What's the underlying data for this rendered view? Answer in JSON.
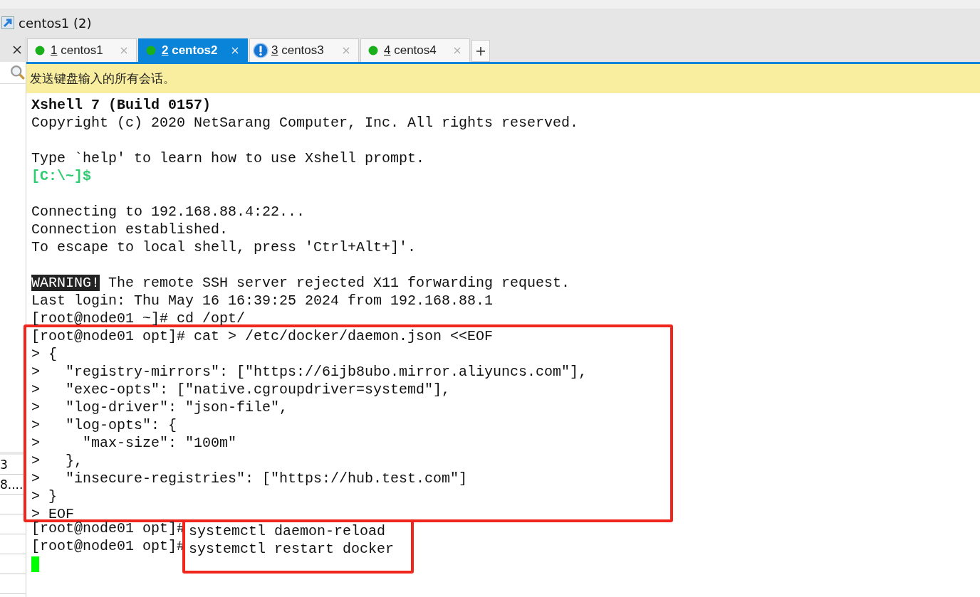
{
  "window": {
    "title": "centos1 (2)"
  },
  "tabs": [
    {
      "number": "1",
      "label": "centos1",
      "kind": "connected",
      "selected": false
    },
    {
      "number": "2",
      "label": "centos2",
      "kind": "connected",
      "selected": true
    },
    {
      "number": "3",
      "label": "centos3",
      "kind": "alert",
      "selected": false
    },
    {
      "number": "4",
      "label": "centos4",
      "kind": "connected",
      "selected": false
    }
  ],
  "banner": "发送键盘输入的所有会话。",
  "sidebar": {
    "items": [
      "3",
      "8...."
    ]
  },
  "terminal": {
    "blocks": [
      {
        "kind": "plain",
        "lines": [
          {
            "kind": "bold",
            "text": "Xshell 7 (Build 0157)"
          },
          {
            "kind": "plain",
            "text": "Copyright (c) 2020 NetSarang Computer, Inc. All rights reserved."
          },
          {
            "kind": "blank"
          },
          {
            "kind": "plain",
            "text": "Type `help' to learn how to use Xshell prompt."
          },
          {
            "kind": "prompt",
            "text": "[C:\\~]$"
          },
          {
            "kind": "blank"
          },
          {
            "kind": "plain",
            "text": "Connecting to 192.168.88.4:22..."
          },
          {
            "kind": "plain",
            "text": "Connection established."
          },
          {
            "kind": "plain",
            "text": "To escape to local shell, press 'Ctrl+Alt+]'."
          },
          {
            "kind": "blank"
          },
          {
            "kind": "warning",
            "label": "WARNING!",
            "text": " The remote SSH server rejected X11 forwarding request."
          },
          {
            "kind": "plain",
            "text": "Last login: Thu May 16 16:39:25 2024 from 192.168.88.1"
          },
          {
            "kind": "plain",
            "text": "[root@node01 ~]# cd /opt/"
          }
        ]
      },
      {
        "kind": "boxed",
        "lines": [
          {
            "kind": "plain",
            "text": "[root@node01 opt]# cat > /etc/docker/daemon.json <<EOF"
          },
          {
            "kind": "plain",
            "text": "> {"
          },
          {
            "kind": "plain",
            "text": ">   \"registry-mirrors\": [\"https://6ijb8ubo.mirror.aliyuncs.com\"],"
          },
          {
            "kind": "plain",
            "text": ">   \"exec-opts\": [\"native.cgroupdriver=systemd\"],"
          },
          {
            "kind": "plain",
            "text": ">   \"log-driver\": \"json-file\","
          },
          {
            "kind": "plain",
            "text": ">   \"log-opts\": {"
          },
          {
            "kind": "plain",
            "text": ">     \"max-size\": \"100m\""
          },
          {
            "kind": "plain",
            "text": ">   },"
          },
          {
            "kind": "plain",
            "text": ">   \"insecure-registries\": [\"https://hub.test.com\"]"
          },
          {
            "kind": "plain",
            "text": "> }"
          },
          {
            "kind": "plain",
            "text": "> EOF"
          }
        ]
      },
      {
        "kind": "boxed_commands",
        "lines": [
          {
            "prompt": "[root@node01 opt]#",
            "command": "systemctl daemon-reload"
          },
          {
            "prompt": "[root@node01 opt]#",
            "command": "systemctl restart docker"
          }
        ]
      }
    ],
    "cursor": true
  }
}
